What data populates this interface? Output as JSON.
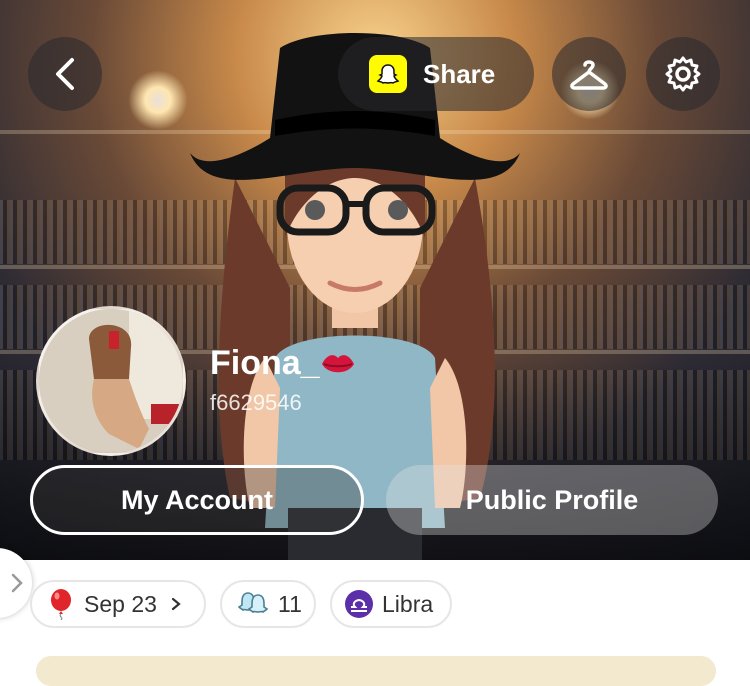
{
  "header": {
    "share_label": "Share"
  },
  "profile": {
    "display_name": "Fiona_",
    "username": "f6629546"
  },
  "actions": {
    "my_account": "My Account",
    "public_profile": "Public Profile"
  },
  "chips": [
    {
      "label": "Sep 23",
      "icon": "balloon-icon"
    },
    {
      "label": "11",
      "icon": "ghost-friends-icon"
    },
    {
      "label": "Libra",
      "icon": "libra-icon"
    }
  ],
  "colors": {
    "snap_yellow": "#fffc00",
    "libra_purple": "#5b2fa7",
    "balloon_red": "#e0252b"
  }
}
